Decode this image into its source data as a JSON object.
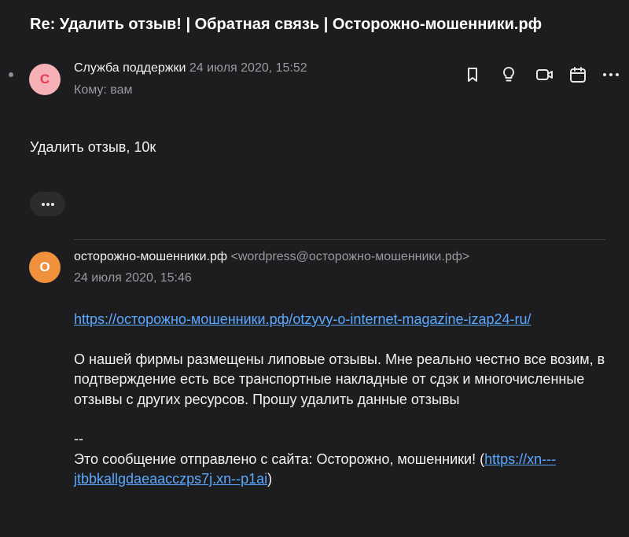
{
  "subject": "Re: Удалить отзыв! | Обратная связь | Осторожно-мошенники.рф",
  "message": {
    "avatar_letter": "С",
    "sender_name": "Служба поддержки",
    "date": "24 июля 2020, 15:52",
    "recipient": "Кому: вам",
    "body": "Удалить отзыв, 10к"
  },
  "toolbar": {
    "icons": [
      "bookmark-icon",
      "lightbulb-icon",
      "video-call-icon",
      "calendar-icon",
      "more-icon"
    ]
  },
  "quoted": {
    "avatar_letter": "О",
    "sender_name": "осторожно-мошенники.рф",
    "sender_email": "<wordpress@осторожно-мошенники.рф>",
    "date": "24 июля 2020, 15:46",
    "link": "https://осторожно-мошенники.рф/otzyvy-o-internet-magazine-izap24-ru/",
    "paragraph": "О нашей фирмы размещены липовые отзывы. Мне реально честно все возим, в подтверждение есть все транспортные накладные от сдэк и многочисленные отзывы с других ресурсов. Прошу удалить данные отзывы",
    "signature_dash": "--",
    "footer_text": "Это сообщение отправлено с сайта: Осторожно, мошенники! (",
    "footer_link": "https://xn---jtbbkallgdaeaacczps7j.xn--p1ai",
    "footer_close": ")"
  },
  "colors": {
    "background": "#1d1d1f",
    "link": "#5aa9ff",
    "avatar1_bg": "#f6b0b6",
    "avatar2_bg": "#f0913e"
  }
}
